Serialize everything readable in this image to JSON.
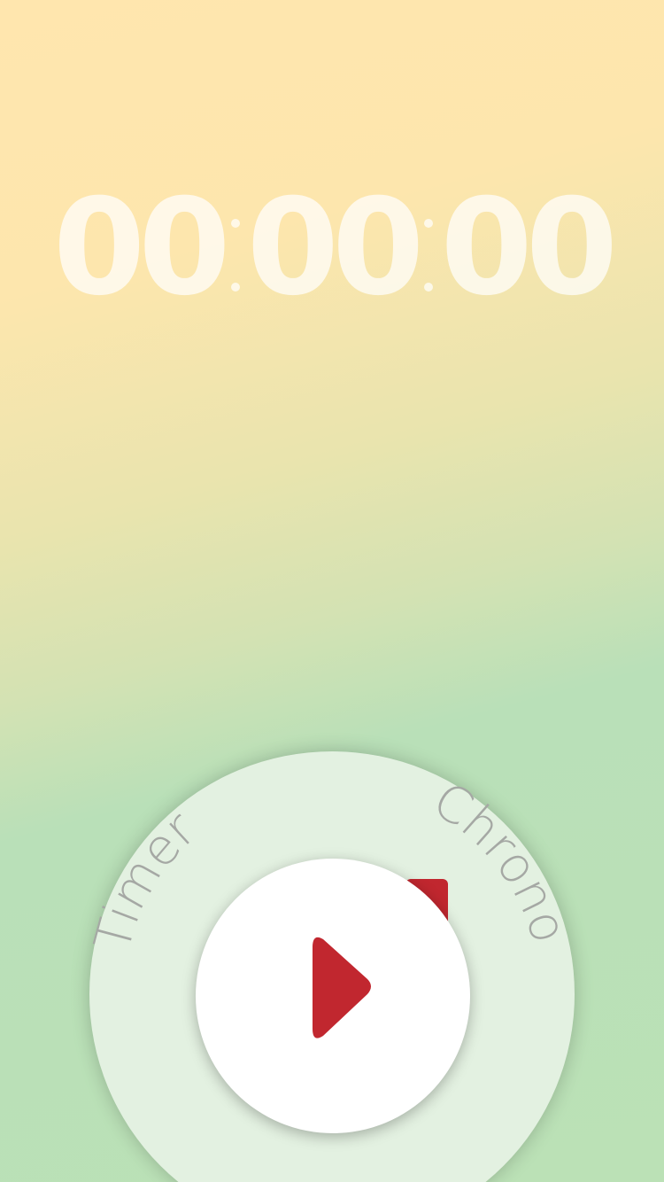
{
  "timer": {
    "hours": "00",
    "minutes": "00",
    "seconds": "00"
  },
  "modes": {
    "timer_label": "Timer",
    "chrono_label": "Chrono",
    "selected": "Chrono"
  },
  "controls": {
    "play_icon": "play-icon"
  },
  "colors": {
    "background_top": "#ffe6ae",
    "background_bottom": "#bbe1b6",
    "dial": "#e3f1e1",
    "accent": "#c1272f",
    "label": "#a5a8a4",
    "button": "#ffffff"
  }
}
